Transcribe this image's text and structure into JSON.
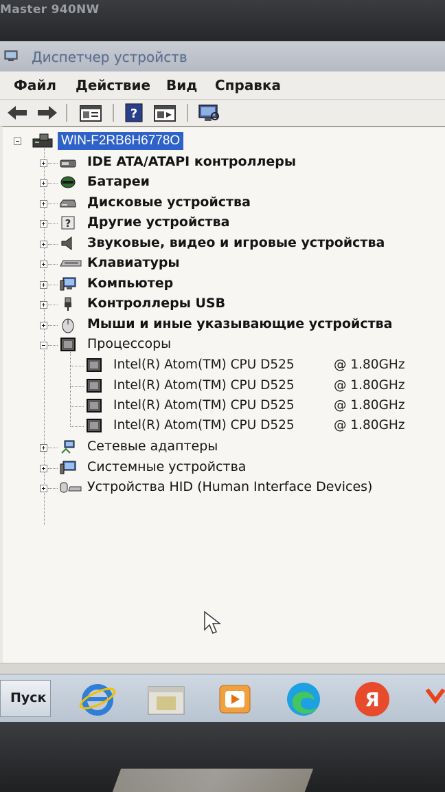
{
  "monitor": {
    "brand": "Master 940NW"
  },
  "window": {
    "title": "Диспетчер устройств"
  },
  "menu": {
    "items": [
      "Файл",
      "Действие",
      "Вид",
      "Справка"
    ]
  },
  "toolbar": {
    "buttons": [
      "back-arrow",
      "forward-arrow",
      "properties",
      "help",
      "show-hide-console",
      "scan-hardware"
    ]
  },
  "tree": {
    "root": "WIN-F2RB6H6778O",
    "categories": [
      {
        "label": "IDE ATA/ATAPI контроллеры",
        "icon": "ide-controller-icon",
        "expanded": false
      },
      {
        "label": "Батареи",
        "icon": "battery-icon",
        "expanded": false
      },
      {
        "label": "Дисковые устройства",
        "icon": "disk-drive-icon",
        "expanded": false
      },
      {
        "label": "Другие устройства",
        "icon": "unknown-device-icon",
        "expanded": false
      },
      {
        "label": "Звуковые, видео и игровые устройства",
        "icon": "speaker-icon",
        "expanded": false
      },
      {
        "label": "Клавиатуры",
        "icon": "keyboard-icon",
        "expanded": false
      },
      {
        "label": "Компьютер",
        "icon": "computer-icon",
        "expanded": false
      },
      {
        "label": "Контроллеры USB",
        "icon": "usb-icon",
        "expanded": false
      },
      {
        "label": "Мыши и иные указывающие устройства",
        "icon": "mouse-icon",
        "expanded": false
      },
      {
        "label": "Процессоры",
        "icon": "processor-icon",
        "expanded": true
      },
      {
        "label": "Сетевые адаптеры",
        "icon": "network-adapter-icon",
        "expanded": false
      },
      {
        "label": "Системные устройства",
        "icon": "system-device-icon",
        "expanded": false
      },
      {
        "label": "Устройства HID (Human Interface Devices)",
        "icon": "hid-device-icon",
        "expanded": false
      }
    ],
    "processors": [
      {
        "name": "Intel(R) Atom(TM) CPU D525",
        "freq": "@ 1.80GHz"
      },
      {
        "name": "Intel(R) Atom(TM) CPU D525",
        "freq": "@ 1.80GHz"
      },
      {
        "name": "Intel(R) Atom(TM) CPU D525",
        "freq": "@ 1.80GHz"
      },
      {
        "name": "Intel(R) Atom(TM) CPU D525",
        "freq": "@ 1.80GHz"
      }
    ]
  },
  "taskbar": {
    "start_label": "Пуск",
    "apps": [
      "internet-explorer-icon",
      "file-manager-icon",
      "media-player-icon",
      "edge-icon",
      "yandex-browser-icon"
    ]
  },
  "colors": {
    "selection": "#2f62c8",
    "window_bg": "#f7f6f3",
    "taskbar": "#c5cfdb"
  }
}
